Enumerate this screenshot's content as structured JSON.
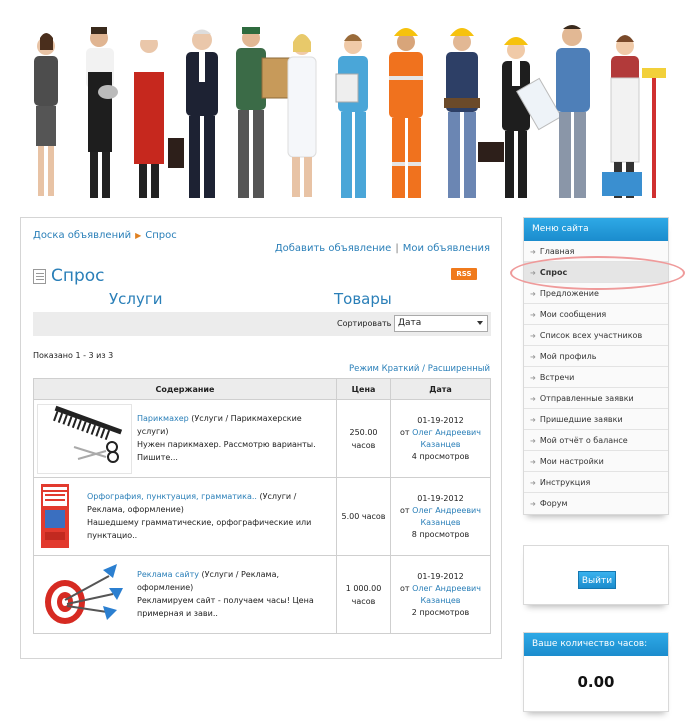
{
  "breadcrumb": {
    "root": "Доска объявлений",
    "current": "Спрос"
  },
  "top_links": {
    "add": "Добавить объявление",
    "separator": "|",
    "mine": "Мои объявления"
  },
  "page_title": "Спрос",
  "rss_label": "RSS",
  "categories": {
    "services": "Услуги",
    "goods": "Товары"
  },
  "sort": {
    "label": "Сортировать по",
    "value": "Дата"
  },
  "shown": "Показано 1 - 3 из 3",
  "mode": {
    "prefix": "Режим",
    "short": "Краткий",
    "sep": "/",
    "full": "Расширенный"
  },
  "table": {
    "headers": {
      "content": "Содержание",
      "price": "Цена",
      "date": "Дата"
    },
    "rows": [
      {
        "title": "Парикмахер",
        "category": "(Услуги / Парикмахерские услуги)",
        "text": "Нужен парикмахер. Рассмотрю варианты. Пишите...",
        "price_value": "250.00",
        "price_unit": "часов",
        "date": "01-19-2012",
        "author_prefix": "от",
        "author": "Олег Андреевич Казанцев",
        "views": "4 просмотров"
      },
      {
        "title": "Орфография, пунктуация, грамматика..",
        "category": "(Услуги / Реклама, оформление)",
        "text": "Нашедшему грамматические, орфографические или пунктацио..",
        "price_value": "5.00 часов",
        "price_unit": "",
        "date": "01-19-2012",
        "author_prefix": "от",
        "author": "Олег Андреевич Казанцев",
        "views": "8 просмотров"
      },
      {
        "title": "Реклама сайту",
        "category": "(Услуги / Реклама, оформление)",
        "text": "Рекламируем сайт - получаем часы! Цена примерная и зави..",
        "price_value": "1 000.00",
        "price_unit": "часов",
        "date": "01-19-2012",
        "author_prefix": "от",
        "author": "Олег Андреевич Казанцев",
        "views": "2 просмотров"
      }
    ]
  },
  "sidebar": {
    "menu_title": "Меню сайта",
    "items": [
      {
        "label": "Главная"
      },
      {
        "label": "Спрос"
      },
      {
        "label": "Предложение"
      },
      {
        "label": "Мои сообщения"
      },
      {
        "label": "Список всех участников"
      },
      {
        "label": "Мой профиль"
      },
      {
        "label": "Встречи"
      },
      {
        "label": "Отправленные заявки"
      },
      {
        "label": "Пришедшие заявки"
      },
      {
        "label": "Мой отчёт о балансе"
      },
      {
        "label": "Мои настройки"
      },
      {
        "label": "Инструкция"
      },
      {
        "label": "Форум"
      }
    ],
    "logout_label": "Выйти",
    "hours_title": "Ваше количество часов:",
    "hours_value": "0.00"
  },
  "colors": {
    "accent": "#2a7fb8",
    "header_blue": "#1b8ccd",
    "rss": "#f07a1c",
    "highlight": "#ef9a9a"
  }
}
